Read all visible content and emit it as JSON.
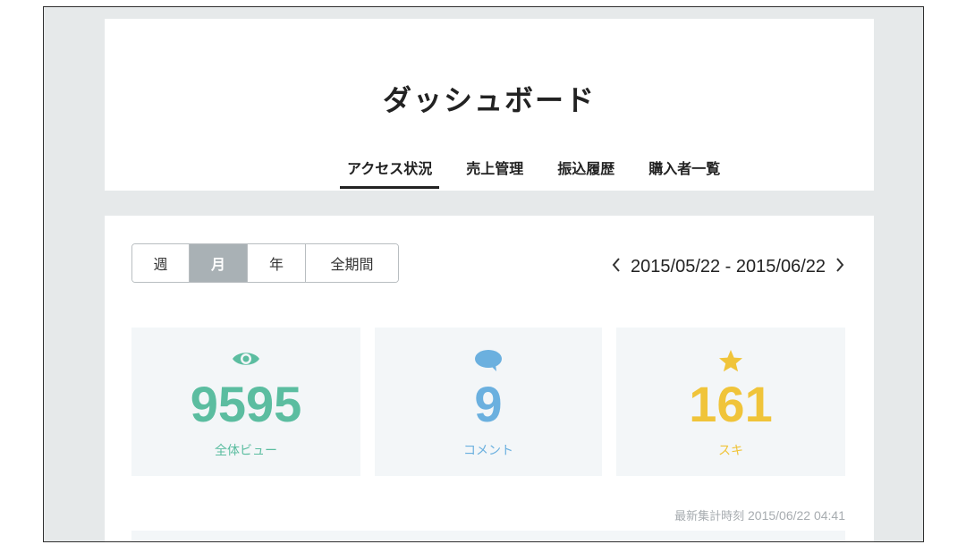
{
  "header": {
    "title": "ダッシュボード",
    "tabs": [
      {
        "label": "アクセス状況",
        "active": true
      },
      {
        "label": "売上管理",
        "active": false
      },
      {
        "label": "振込履歴",
        "active": false
      },
      {
        "label": "購入者一覧",
        "active": false
      }
    ]
  },
  "period": {
    "options": [
      "週",
      "月",
      "年",
      "全期間"
    ],
    "selected": "月"
  },
  "date_range": {
    "prev_icon": "chevron-left-icon",
    "text": "2015/05/22 - 2015/06/22",
    "next_icon": "chevron-right-icon"
  },
  "stats": {
    "views": {
      "value": "9595",
      "label": "全体ビュー",
      "icon": "eye-icon",
      "color": "#5bbda0"
    },
    "comments": {
      "value": "9",
      "label": "コメント",
      "icon": "speech-bubble-icon",
      "color": "#6bb0df"
    },
    "likes": {
      "value": "161",
      "label": "スキ",
      "icon": "star-icon",
      "color": "#f0c43a"
    }
  },
  "updated": {
    "label": "最新集計時刻",
    "time": "2015/06/22 04:41"
  },
  "colors": {
    "background": "#e6e9ea",
    "card": "#ffffff",
    "stat_card": "#f3f6f8",
    "active_period": "#a9b1b5"
  }
}
